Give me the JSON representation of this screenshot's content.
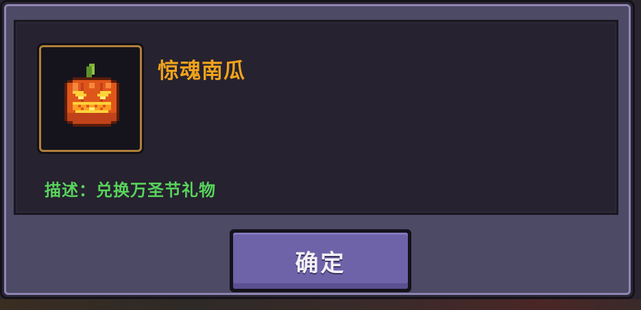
{
  "item": {
    "name": "惊魂南瓜",
    "description": "描述：兑换万圣节礼物",
    "icon": "jack-o-lantern-icon"
  },
  "dialog": {
    "confirm_label": "确定"
  },
  "colors": {
    "name_color": "#f0a21d",
    "description_color": "#58d45c",
    "frame_border": "#b0803a",
    "button_face": "#6e62a8",
    "panel_bg": "#26222f",
    "dialog_bg": "#4d4a66"
  }
}
